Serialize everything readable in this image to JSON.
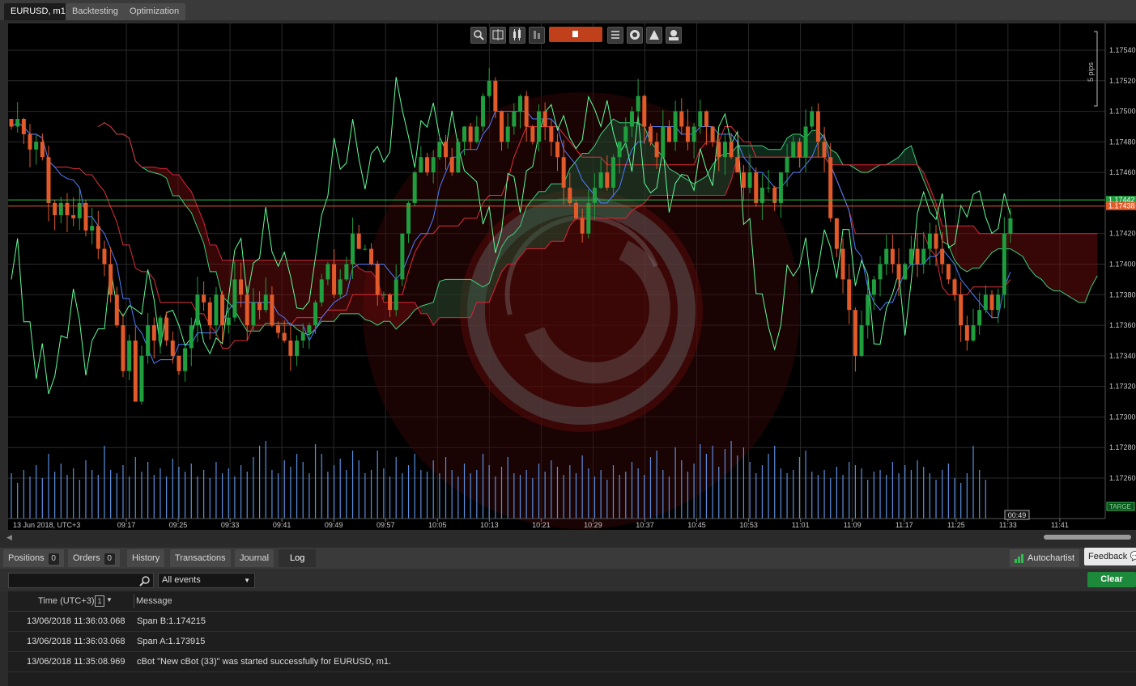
{
  "top_tabs": [
    "EURUSD, m1",
    "Backtesting",
    "Optimization"
  ],
  "chart_data": {
    "type": "candlestick",
    "symbol": "EURUSD",
    "timeframe": "m1",
    "x_labels": [
      "09:17",
      "09:25",
      "09:33",
      "09:41",
      "09:49",
      "09:57",
      "10:05",
      "10:13",
      "10:21",
      "10:29",
      "10:37",
      "10:45",
      "10:53",
      "11:01",
      "11:09",
      "11:17",
      "11:25",
      "11:33",
      "11:41"
    ],
    "date_label": "13 Jun 2018, UTC+3",
    "y_ticks": [
      "1.17540",
      "1.17520",
      "1.17500",
      "1.17480",
      "1.17460",
      "1.17420",
      "1.17400",
      "1.17380",
      "1.17360",
      "1.17340",
      "1.17320",
      "1.17300",
      "1.17280",
      "1.17260"
    ],
    "ylim": [
      1.1724,
      1.1756
    ],
    "price_markers": {
      "ask": "1.17442",
      "bid": "1.17438"
    },
    "scale_note": "5 pips",
    "countdown": "00:49",
    "target_label": "TARGE",
    "closes": [
      1.1749,
      1.17495,
      1.17485,
      1.17475,
      1.1748,
      1.1747,
      1.1744,
      1.17432,
      1.1744,
      1.17432,
      1.1743,
      1.1744,
      1.17422,
      1.17425,
      1.1741,
      1.174,
      1.1738,
      1.1736,
      1.1733,
      1.1735,
      1.1731,
      1.1734,
      1.1736,
      1.1735,
      1.17365,
      1.1735,
      1.1734,
      1.1733,
      1.17345,
      1.1736,
      1.1738,
      1.17375,
      1.1736,
      1.1738,
      1.1736,
      1.17365,
      1.1739,
      1.1738,
      1.1736,
      1.17375,
      1.1737,
      1.1738,
      1.1736,
      1.17355,
      1.1735,
      1.1734,
      1.1735,
      1.17355,
      1.1736,
      1.17375,
      1.1739,
      1.174,
      1.1738,
      1.1739,
      1.174,
      1.1742,
      1.1741,
      1.1741,
      1.174,
      1.1738,
      1.1738,
      1.1737,
      1.1739,
      1.1742,
      1.1744,
      1.1746,
      1.1747,
      1.1746,
      1.1747,
      1.1748,
      1.1747,
      1.1746,
      1.1748,
      1.1749,
      1.1748,
      1.1749,
      1.1751,
      1.1752,
      1.175,
      1.1748,
      1.1749,
      1.175,
      1.1751,
      1.1749,
      1.1748,
      1.175,
      1.1749,
      1.1748,
      1.1747,
      1.1745,
      1.1744,
      1.1743,
      1.1742,
      1.1744,
      1.1745,
      1.1746,
      1.1745,
      1.1747,
      1.1748,
      1.1749,
      1.175,
      1.1751,
      1.1749,
      1.1748,
      1.1747,
      1.1749,
      1.1748,
      1.175,
      1.1749,
      1.1748,
      1.1749,
      1.175,
      1.1749,
      1.1748,
      1.1747,
      1.1748,
      1.1747,
      1.1746,
      1.1745,
      1.1746,
      1.1744,
      1.1745,
      1.1745,
      1.1744,
      1.1746,
      1.1747,
      1.1748,
      1.1747,
      1.1749,
      1.175,
      1.1748,
      1.1747,
      1.1743,
      1.1741,
      1.1739,
      1.1737,
      1.1734,
      1.1736,
      1.1738,
      1.1739,
      1.174,
      1.1741,
      1.174,
      1.1739,
      1.174,
      1.1741,
      1.174,
      1.1741,
      1.1742,
      1.1741,
      1.174,
      1.1739,
      1.1738,
      1.1736,
      1.1735,
      1.1736,
      1.1737,
      1.1738,
      1.1737,
      1.1738,
      1.1742,
      1.1743
    ],
    "volumes": [
      28,
      22,
      30,
      26,
      33,
      25,
      40,
      29,
      34,
      27,
      31,
      24,
      36,
      30,
      27,
      45,
      30,
      28,
      33,
      26,
      38,
      29,
      35,
      27,
      31,
      26,
      37,
      32,
      29,
      34,
      26,
      30,
      25,
      35,
      28,
      31,
      26,
      33,
      29,
      38,
      45,
      48,
      30,
      28,
      36,
      32,
      40,
      35,
      28,
      46,
      40,
      29,
      33,
      37,
      30,
      42,
      36,
      28,
      30,
      42,
      31,
      26,
      38,
      28,
      33,
      40,
      30,
      29,
      36,
      28,
      38,
      30,
      26,
      34,
      28,
      30,
      40,
      33,
      26,
      32,
      38,
      28,
      27,
      30,
      25,
      34,
      29,
      36,
      32,
      27,
      33,
      28,
      39,
      31,
      26,
      30,
      24,
      33,
      27,
      29,
      35,
      31,
      27,
      38,
      42,
      30,
      26,
      44,
      36,
      29,
      34,
      46,
      40,
      45,
      32,
      43,
      48,
      39,
      44,
      35,
      28,
      33,
      40,
      45,
      31,
      28,
      30,
      38,
      42,
      29,
      27,
      30,
      25,
      32,
      27,
      35,
      33,
      31,
      24,
      29,
      30,
      27,
      35,
      28,
      33,
      30,
      36,
      32,
      28,
      24,
      30,
      34,
      25,
      22,
      28,
      45,
      30,
      24
    ],
    "series": [
      {
        "name": "Span A",
        "color": "#3dcf7a"
      },
      {
        "name": "Span B",
        "color": "#d8263a"
      }
    ]
  },
  "toolbar_icons": [
    "zoom-icon",
    "crosshair-icon",
    "candles-icon",
    "bars-icon",
    "stop-icon",
    "list-icon",
    "layers-icon",
    "drawing-icon",
    "objects-icon"
  ],
  "bottom_tabs": [
    {
      "label": "Positions",
      "count": "0"
    },
    {
      "label": "Orders",
      "count": "0"
    },
    {
      "label": "History"
    },
    {
      "label": "Transactions"
    },
    {
      "label": "Journal"
    },
    {
      "label": "Log"
    }
  ],
  "autochartist_label": "Autochartist",
  "feedback_label": "Feedback",
  "search": {
    "value": "",
    "placeholder": ""
  },
  "events_filter": {
    "selected": "All events"
  },
  "clear_label": "Clear",
  "log": {
    "time_header": "Time (UTC+3)",
    "sort_index": "1",
    "message_header": "Message",
    "rows": [
      {
        "time": "13/06/2018 11:36:03.068",
        "message": "Span B:1.174215"
      },
      {
        "time": "13/06/2018 11:36:03.068",
        "message": "Span A:1.173915"
      },
      {
        "time": "13/06/2018 11:35:08.969",
        "message": "cBot \"New cBot (33)\" was started successfully for EURUSD, m1."
      }
    ]
  },
  "colors": {
    "bull": "#1f9e3e",
    "bear": "#e25a2a",
    "grid": "#2a2a2a",
    "accent": "#c0401c",
    "clear": "#1c8a3a",
    "volume": "#5b8fe0"
  }
}
